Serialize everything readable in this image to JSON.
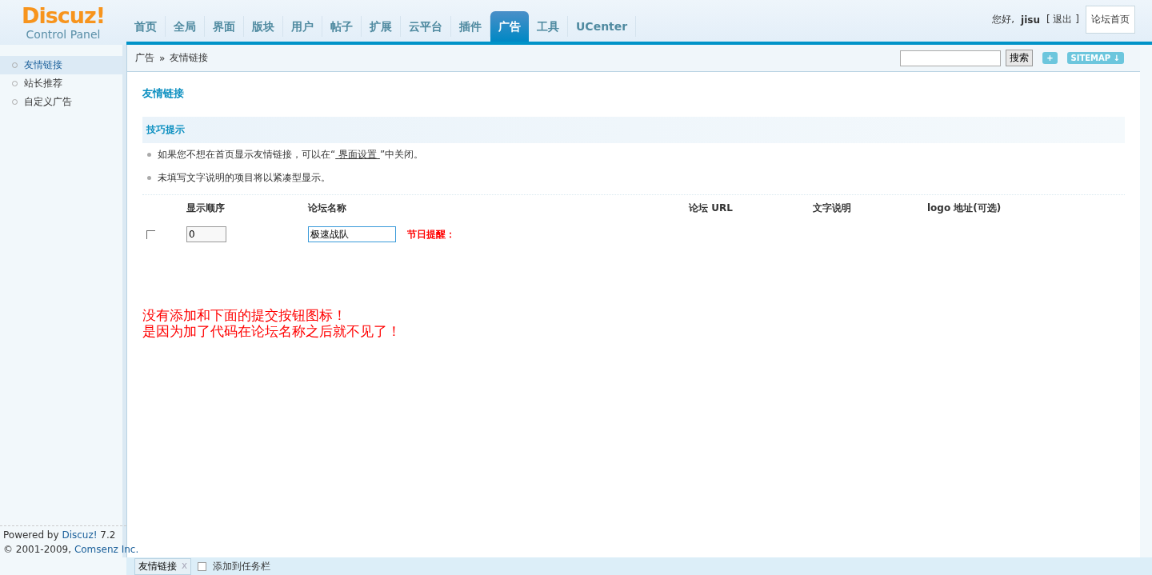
{
  "logo": {
    "name": "Discuz!",
    "subtitle": "Control Panel"
  },
  "nav": [
    {
      "label": "首页",
      "selected": false
    },
    {
      "label": "全局",
      "selected": false
    },
    {
      "label": "界面",
      "selected": false
    },
    {
      "label": "版块",
      "selected": false
    },
    {
      "label": "用户",
      "selected": false
    },
    {
      "label": "帖子",
      "selected": false
    },
    {
      "label": "扩展",
      "selected": false
    },
    {
      "label": "云平台",
      "selected": false
    },
    {
      "label": "插件",
      "selected": false
    },
    {
      "label": "广告",
      "selected": true
    },
    {
      "label": "工具",
      "selected": false
    },
    {
      "label": "UCenter",
      "selected": false
    }
  ],
  "user": {
    "greeting": "您好,",
    "name": "jisu",
    "logout": "[ 退出 ]",
    "home_button": "论坛首页"
  },
  "breadcrumb": {
    "parent": "广告",
    "separator": "»",
    "current": "友情链接"
  },
  "search": {
    "button": "搜索",
    "add": "+",
    "sitemap": "SITEMAP ↓"
  },
  "sidebar": {
    "items": [
      {
        "label": "友情链接",
        "selected": true
      },
      {
        "label": "站长推荐",
        "selected": false
      },
      {
        "label": "自定义广告",
        "selected": false
      }
    ]
  },
  "page_title": "友情链接",
  "tips": {
    "title": "技巧提示",
    "items": [
      {
        "before": "如果您不想在首页显示友情链接，可以在“",
        "link": "界面设置",
        "after": "”中关闭。"
      },
      {
        "before": "未填写文字说明的项目将以紧凑型显示。"
      }
    ]
  },
  "table": {
    "columns": [
      "显示顺序",
      "论坛名称",
      "论坛 URL",
      "文字说明",
      "logo 地址(可选)"
    ],
    "rows": [
      {
        "checked": false,
        "order": "0",
        "name": "极速战队",
        "note": "节日提醒："
      }
    ]
  },
  "remark": [
    "没有添加和下面的提交按钮图标！",
    "是因为加了代码在论坛名称之后就不见了！"
  ],
  "footer": {
    "powered": {
      "prefix": "Powered by",
      "link": "Discuz!",
      "suffix": "7.2"
    },
    "copyright": {
      "prefix": "© 2001-2009,",
      "link": "Comsenz Inc."
    }
  },
  "taskbar": {
    "tabs": [
      {
        "label": "友情链接",
        "close": "x"
      }
    ],
    "add": "添加到任务栏"
  }
}
